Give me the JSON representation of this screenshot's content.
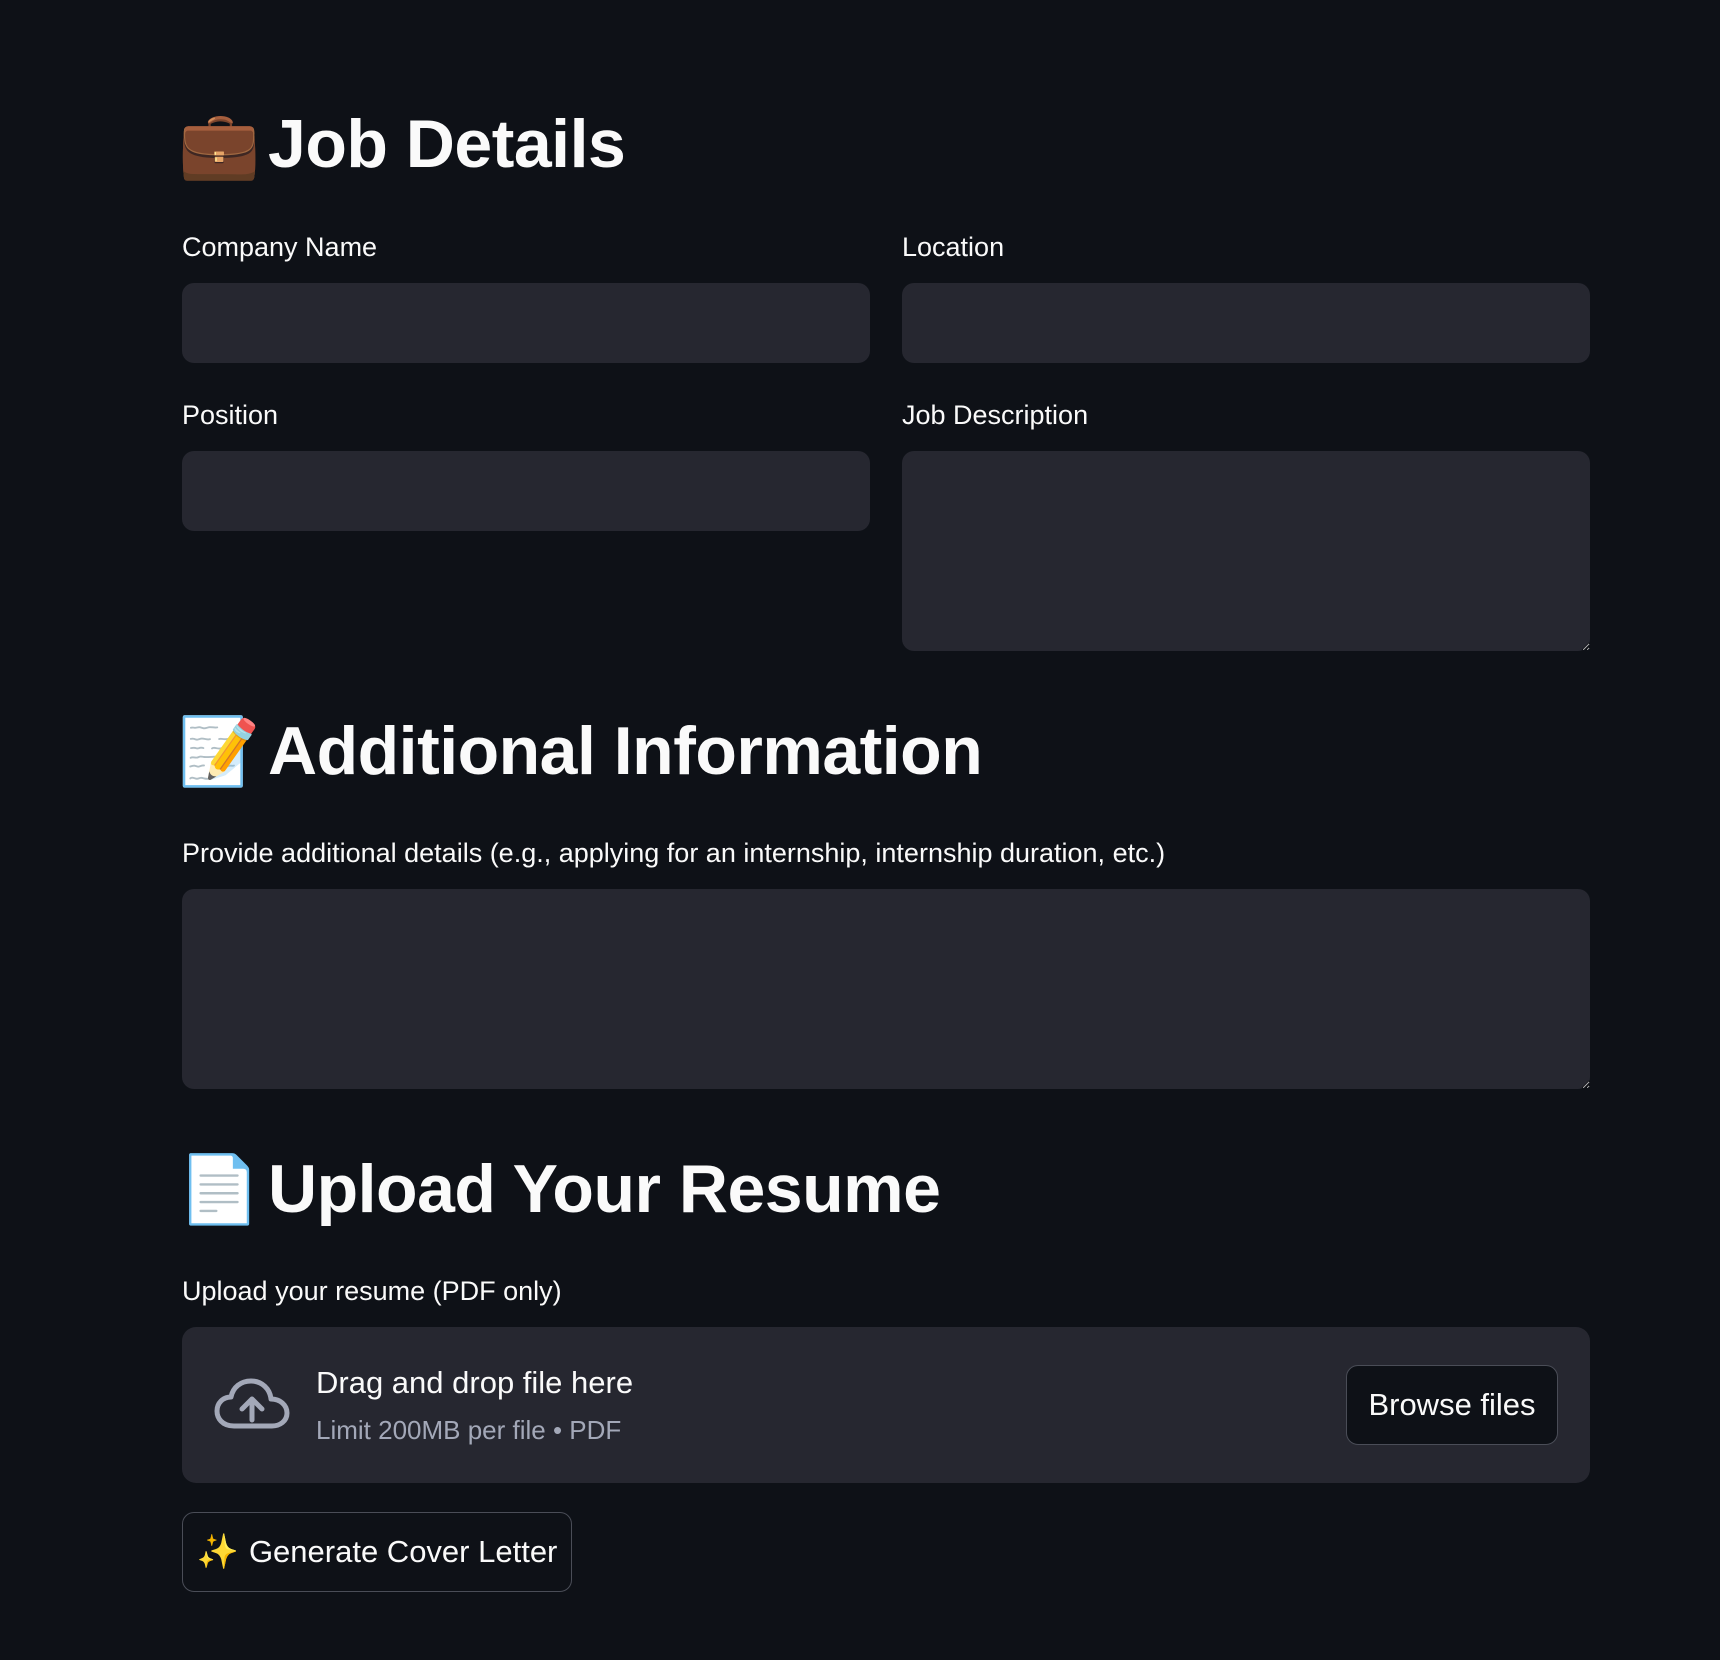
{
  "job_details": {
    "emoji": "💼",
    "title": "Job Details",
    "company_label": "Company Name",
    "location_label": "Location",
    "position_label": "Position",
    "description_label": "Job Description"
  },
  "additional": {
    "emoji": "📝",
    "title": "Additional Information",
    "details_label": "Provide additional details (e.g., applying for an internship, internship duration, etc.)"
  },
  "resume": {
    "emoji": "📄",
    "title": "Upload Your Resume",
    "upload_label": "Upload your resume (PDF only)",
    "drag_text": "Drag and drop file here",
    "limit_text": "Limit 200MB per file • PDF",
    "browse_label": "Browse files",
    "upload_icon": "cloud-upload-icon"
  },
  "actions": {
    "generate_emoji": "✨",
    "generate_label": "Generate Cover Letter"
  },
  "colors": {
    "background": "#0e1117",
    "field": "#262730",
    "text": "#fafafa",
    "muted": "#a3a8b8"
  }
}
